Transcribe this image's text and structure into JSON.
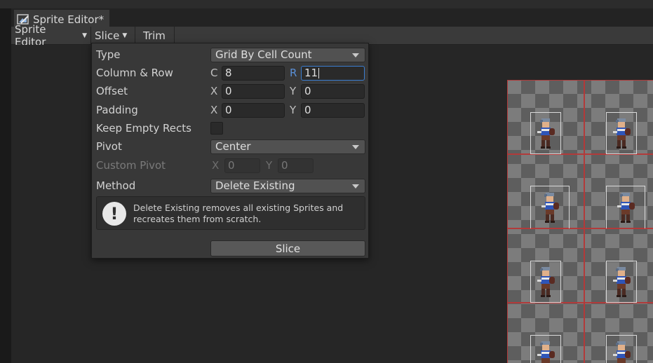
{
  "window": {
    "tab_title": "Sprite Editor*",
    "tab_icon": "sprite-editor-icon"
  },
  "toolbar": {
    "mode_label": "Sprite Editor",
    "slice_label": "Slice",
    "trim_label": "Trim"
  },
  "slice_popup": {
    "type": {
      "label": "Type",
      "value": "Grid By Cell Count"
    },
    "column_row": {
      "label": "Column & Row",
      "c_axis": "C",
      "c_value": "8",
      "r_axis": "R",
      "r_value": "11"
    },
    "offset": {
      "label": "Offset",
      "x_axis": "X",
      "x_value": "0",
      "y_axis": "Y",
      "y_value": "0"
    },
    "padding": {
      "label": "Padding",
      "x_axis": "X",
      "x_value": "0",
      "y_axis": "Y",
      "y_value": "0"
    },
    "keep_empty_rects": {
      "label": "Keep Empty Rects",
      "checked": false
    },
    "pivot": {
      "label": "Pivot",
      "value": "Center"
    },
    "custom_pivot": {
      "label": "Custom Pivot",
      "x_axis": "X",
      "x_value": "0",
      "y_axis": "Y",
      "y_value": "0",
      "enabled": false
    },
    "method": {
      "label": "Method",
      "value": "Delete Existing"
    },
    "help": {
      "icon": "info-icon",
      "text_line1": "Delete Existing removes all existing Sprites and",
      "text_line2": "recreates them from scratch."
    },
    "slice_button_label": "Slice"
  },
  "colors": {
    "accent_focus": "#3b7dd0",
    "grid_line": "#b23a3a",
    "panel_bg": "#383838"
  }
}
